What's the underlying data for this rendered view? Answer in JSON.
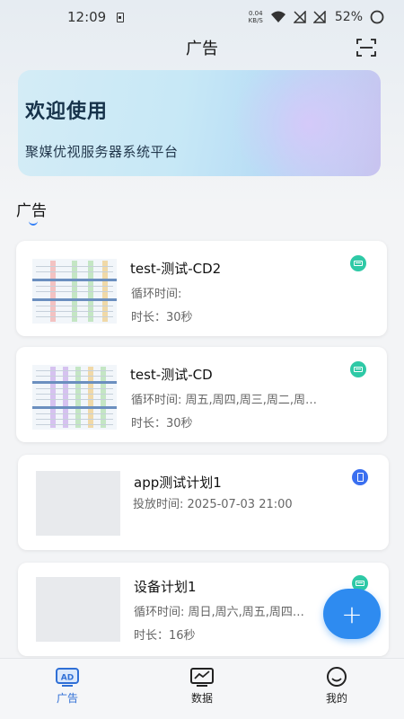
{
  "status_bar": {
    "time": "12:09",
    "net_speed_value": "0.04",
    "net_speed_unit": "KB/S",
    "battery": "52%"
  },
  "header": {
    "title": "广告",
    "scan_icon": "scan-icon"
  },
  "banner": {
    "title": "欢迎使用",
    "subtitle": "聚媒优视服务器系统平台"
  },
  "section": {
    "title": "广告"
  },
  "items": [
    {
      "title": "test-测试-CD2",
      "line1": "循环时间:",
      "line2": "时长：30秒",
      "badge": "display-icon",
      "badge_color": "#2ec9a6"
    },
    {
      "title": "test-测试-CD",
      "line1": "循环时间: 周五,周四,周三,周二,周…",
      "line2": "时长：30秒",
      "badge": "display-icon",
      "badge_color": "#2ec9a6"
    },
    {
      "title": "app测试计划1",
      "line1": "投放时间: 2025-07-03 21:00",
      "line2": "",
      "badge": "phone-icon",
      "badge_color": "#3a6ff0"
    },
    {
      "title": "设备计划1",
      "line1": "循环时间: 周日,周六,周五,周四…",
      "line2": "时长：16秒",
      "badge": "display-icon",
      "badge_color": "#2ec9a6"
    }
  ],
  "fab": {
    "label": "+"
  },
  "tabbar": {
    "tabs": [
      {
        "label": "广告",
        "icon_text": "AD",
        "active": true
      },
      {
        "label": "数据",
        "active": false
      },
      {
        "label": "我的",
        "active": false
      }
    ]
  },
  "colors": {
    "accent": "#2e8bf0",
    "tab_active": "#2f6fd6",
    "badge_teal": "#2ec9a6",
    "badge_blue": "#3a6ff0"
  }
}
